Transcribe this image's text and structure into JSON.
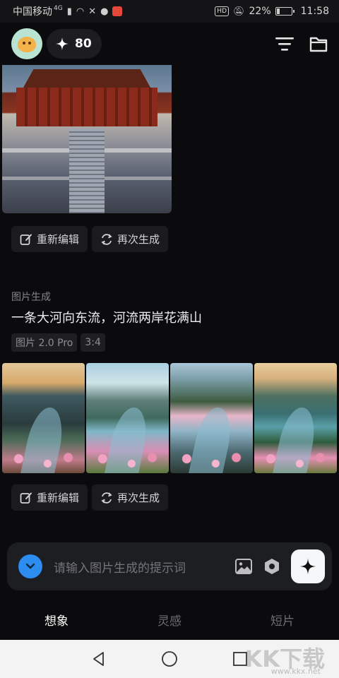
{
  "status_bar": {
    "carrier": "中国移动",
    "network": "4G",
    "battery": "22%",
    "battery_level": 0.22,
    "time": "11:58",
    "hd_label": "HD"
  },
  "header": {
    "credits": "80",
    "icons": [
      "avatar",
      "sparkle-icon",
      "filter-icon",
      "folder-icon"
    ]
  },
  "previous_item": {
    "actions": {
      "re_edit": "重新编辑",
      "regenerate": "再次生成"
    }
  },
  "current_item": {
    "type_label": "图片生成",
    "prompt": "一条大河向东流，河流两岸花满山",
    "tags": [
      "图片 2.0 Pro",
      "3:4"
    ],
    "actions": {
      "re_edit": "重新编辑",
      "regenerate": "再次生成"
    }
  },
  "input": {
    "placeholder": "请输入图片生成的提示词"
  },
  "tabs": [
    {
      "label": "想象",
      "active": true
    },
    {
      "label": "灵感",
      "active": false
    },
    {
      "label": "短片",
      "active": false
    }
  ],
  "watermark": {
    "text": "KK下载",
    "url": "www.kkx.net"
  },
  "colors": {
    "accent": "#2d8cf0",
    "background": "#0b0b0d",
    "card": "#1b1b1f"
  }
}
